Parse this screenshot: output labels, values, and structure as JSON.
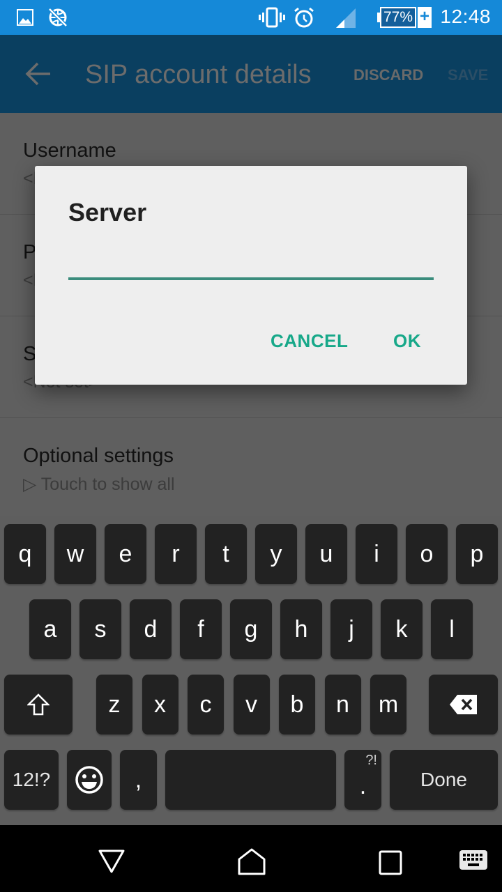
{
  "status_bar": {
    "time": "12:48",
    "battery_percent": "77%",
    "battery_charging_symbol": "+",
    "icons": [
      "gallery-icon",
      "no-internet-globe-icon",
      "vibrate-icon",
      "alarm-icon",
      "signal-icon",
      "battery-icon",
      "charging-icon"
    ]
  },
  "app_bar": {
    "back_icon": "arrow-left-icon",
    "title": "SIP account details",
    "discard_label": "DISCARD",
    "save_label": "SAVE"
  },
  "settings": {
    "rows": [
      {
        "label": "Username",
        "value": "<N"
      },
      {
        "label": "P",
        "value": "<N"
      },
      {
        "label": "S",
        "value": "<Not set>"
      },
      {
        "label": "Optional settings",
        "value": "▷ Touch to show all"
      }
    ]
  },
  "dialog": {
    "title": "Server",
    "input_value": "",
    "cancel_label": "CANCEL",
    "ok_label": "OK",
    "accent_color": "#17a889",
    "underline_color": "#3a8c7c"
  },
  "keyboard": {
    "row1": [
      "q",
      "w",
      "e",
      "r",
      "t",
      "y",
      "u",
      "i",
      "o",
      "p"
    ],
    "row2": [
      "a",
      "s",
      "d",
      "f",
      "g",
      "h",
      "j",
      "k",
      "l"
    ],
    "row3": [
      "z",
      "x",
      "c",
      "v",
      "b",
      "n",
      "m"
    ],
    "shift_icon": "shift-arrow-icon",
    "backspace_icon": "backspace-icon",
    "symbols_label": "12!?",
    "emoji_icon": "smiley-icon",
    "comma_label": ",",
    "period_label": ".",
    "period_alt_label": "?!",
    "done_label": "Done"
  },
  "nav_bar": {
    "icons": [
      "back-triangle-icon",
      "home-icon",
      "recents-icon",
      "keyboard-switch-icon"
    ]
  }
}
